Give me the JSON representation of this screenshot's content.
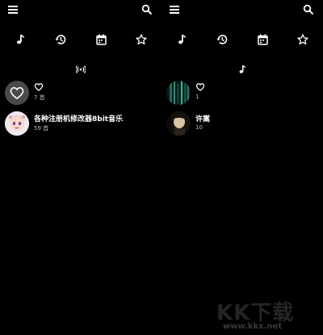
{
  "left_pane": {
    "topbar": {
      "menu_icon": "menu-icon",
      "search_icon": "search-icon"
    },
    "tabs": [
      {
        "icon": "music-note-icon",
        "selected": true
      },
      {
        "icon": "history-icon",
        "selected": false
      },
      {
        "icon": "calendar-icon",
        "selected": false
      },
      {
        "icon": "star-icon",
        "selected": false
      }
    ],
    "section_icon": "radio-waves-icon",
    "items": [
      {
        "title": "",
        "title_icon": "heart-outline-icon",
        "count": "7 首",
        "thumb": "heart-thumb"
      },
      {
        "title": "各种注册机修改器8bit音乐",
        "count": "59 首",
        "thumb": "anime-girl-thumb"
      }
    ]
  },
  "right_pane": {
    "topbar": {
      "menu_icon": "menu-icon",
      "search_icon": "search-icon"
    },
    "tabs": [
      {
        "icon": "music-note-icon",
        "selected": true
      },
      {
        "icon": "history-icon",
        "selected": false
      },
      {
        "icon": "calendar-icon",
        "selected": false
      },
      {
        "icon": "star-icon",
        "selected": false
      }
    ],
    "section_icon": "music-note-icon",
    "items": [
      {
        "title": "",
        "title_icon": "heart-outline-icon",
        "count": "1",
        "thumb": "dark-glitch-thumb"
      },
      {
        "title": "许嵩",
        "count": "10",
        "thumb": "artist-photo-thumb"
      }
    ]
  },
  "watermark": {
    "logo": "KK下载",
    "url": "www.kkx.net"
  },
  "colors": {
    "background": "#000000",
    "text": "#ffffff",
    "subtext": "#bdbdbd"
  }
}
